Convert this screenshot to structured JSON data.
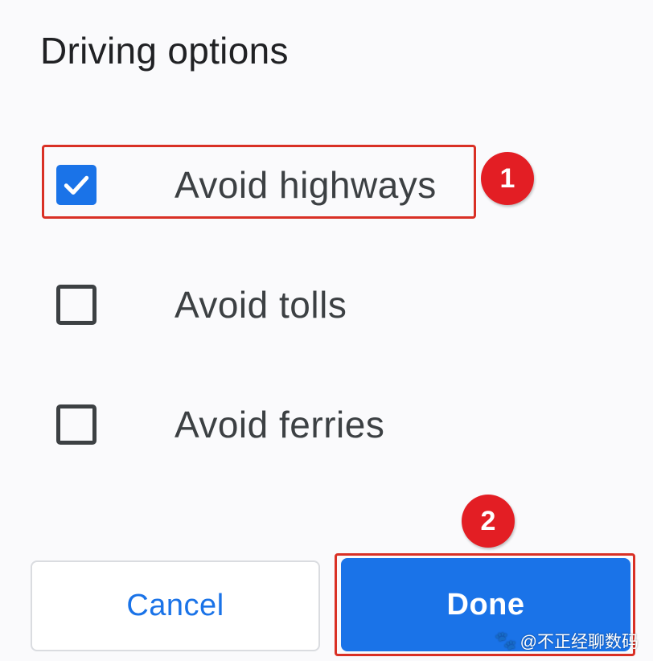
{
  "dialog": {
    "title": "Driving options"
  },
  "options": [
    {
      "label": "Avoid highways",
      "checked": true
    },
    {
      "label": "Avoid tolls",
      "checked": false
    },
    {
      "label": "Avoid ferries",
      "checked": false
    }
  ],
  "annotations": {
    "badge_1": "1",
    "badge_2": "2",
    "highlight_color": "#d93025",
    "badge_color": "#e31e24"
  },
  "buttons": {
    "cancel_label": "Cancel",
    "done_label": "Done"
  },
  "watermark": {
    "icon": "paw-icon",
    "text": "@不正经聊数码"
  },
  "colors": {
    "accent": "#1a73e8",
    "text": "#202124",
    "background": "#fafafc"
  }
}
